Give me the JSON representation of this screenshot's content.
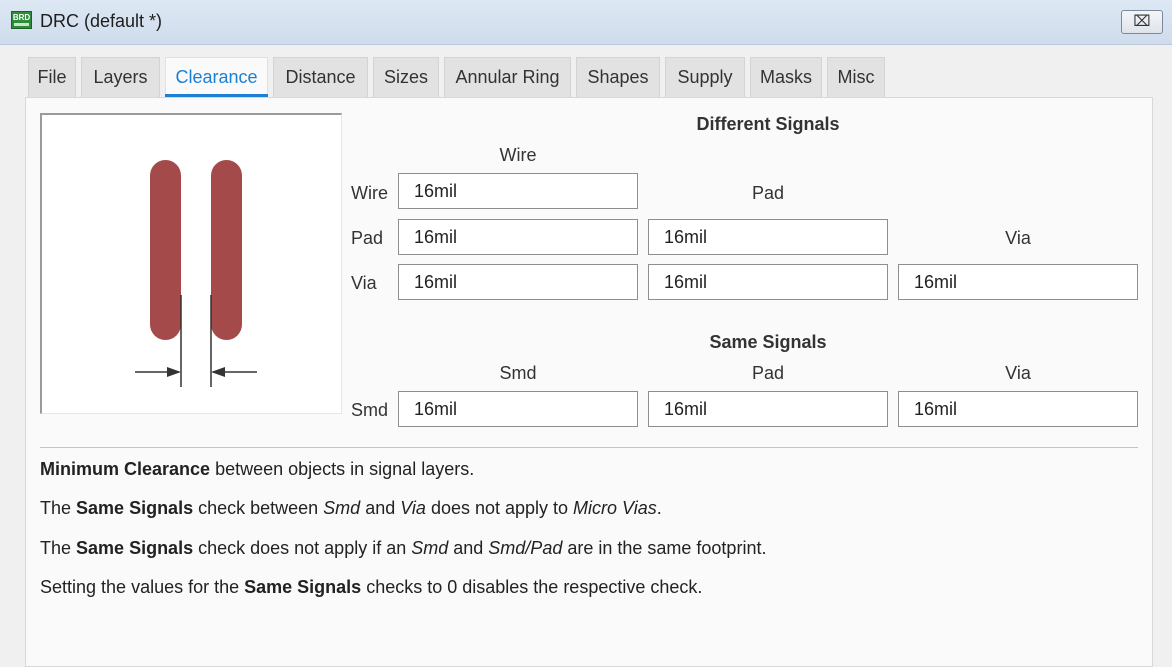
{
  "window": {
    "icon_text": "BRD",
    "title": "DRC (default *)",
    "close_glyph": "⌧"
  },
  "tabs": [
    {
      "label": "File",
      "active": false
    },
    {
      "label": "Layers",
      "active": false
    },
    {
      "label": "Clearance",
      "active": true
    },
    {
      "label": "Distance",
      "active": false
    },
    {
      "label": "Sizes",
      "active": false
    },
    {
      "label": "Annular Ring",
      "active": false
    },
    {
      "label": "Shapes",
      "active": false
    },
    {
      "label": "Supply",
      "active": false
    },
    {
      "label": "Masks",
      "active": false
    },
    {
      "label": "Misc",
      "active": false
    }
  ],
  "colors": {
    "accent": "#1c7fd6",
    "trace": "#a54a4a"
  },
  "different_signals": {
    "heading": "Different Signals",
    "col_wire": "Wire",
    "col_pad": "Pad",
    "col_via": "Via",
    "row_wire": "Wire",
    "row_pad": "Pad",
    "row_via": "Via",
    "wire_wire": "16mil",
    "pad_wire": "16mil",
    "pad_pad": "16mil",
    "via_wire": "16mil",
    "via_pad": "16mil",
    "via_via": "16mil"
  },
  "same_signals": {
    "heading": "Same Signals",
    "col_smd": "Smd",
    "col_pad": "Pad",
    "col_via": "Via",
    "row_smd": "Smd",
    "smd_smd": "16mil",
    "smd_pad": "16mil",
    "smd_via": "16mil"
  },
  "info": {
    "line1": {
      "b1": "Minimum Clearance",
      "t1": " between objects in signal layers."
    },
    "line2": {
      "t0": "The ",
      "b1": "Same Signals",
      "t1": " check between ",
      "i1": "Smd",
      "t2": " and ",
      "i2": "Via",
      "t3": " does not apply to ",
      "i3": "Micro Vias",
      "t4": "."
    },
    "line3": {
      "t0": "The ",
      "b1": "Same Signals",
      "t1": " check does not apply if an ",
      "i1": "Smd",
      "t2": " and ",
      "i2": "Smd/Pad",
      "t3": " are in the same footprint."
    },
    "line4": {
      "t0": "Setting the values for the ",
      "b1": "Same Signals",
      "t1": " checks to 0 disables the respective check."
    }
  }
}
